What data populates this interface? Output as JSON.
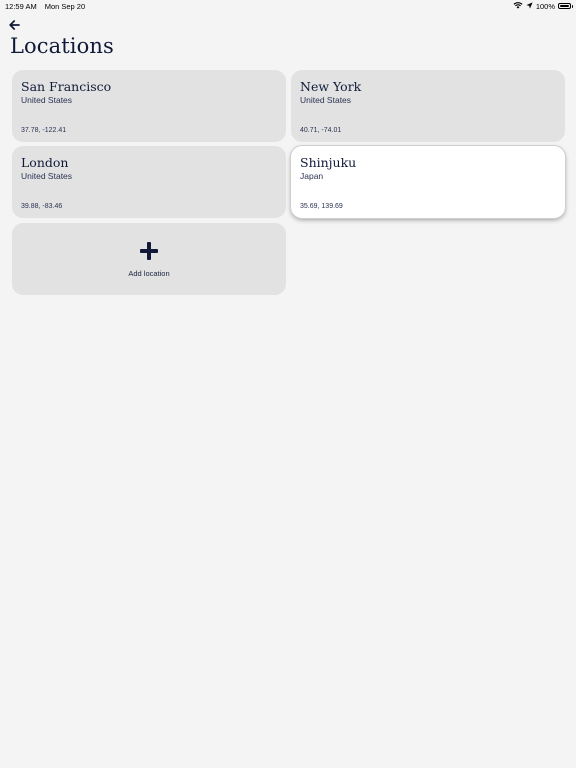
{
  "status_bar": {
    "time": "12:59 AM",
    "date": "Mon Sep 20",
    "battery": "100%",
    "battery_level": 1.0,
    "icons": [
      "wifi-icon",
      "location-arrow-icon",
      "battery-icon"
    ]
  },
  "header": {
    "back_icon": "arrow-left-icon",
    "title": "Locations"
  },
  "locations": [
    {
      "name": "San Francisco",
      "country": "United States",
      "coords": "37.78, -122.41",
      "selected": false
    },
    {
      "name": "New York",
      "country": "United States",
      "coords": "40.71, -74.01",
      "selected": false
    },
    {
      "name": "London",
      "country": "United States",
      "coords": "39.88, -83.46",
      "selected": false
    },
    {
      "name": "Shinjuku",
      "country": "Japan",
      "coords": "35.69, 139.69",
      "selected": true
    }
  ],
  "add_location": {
    "icon": "plus-icon",
    "label": "Add location"
  },
  "colors": {
    "background": "#f4f4f4",
    "card": "#e2e2e2",
    "card_selected": "#ffffff",
    "text_primary": "#101a38"
  }
}
